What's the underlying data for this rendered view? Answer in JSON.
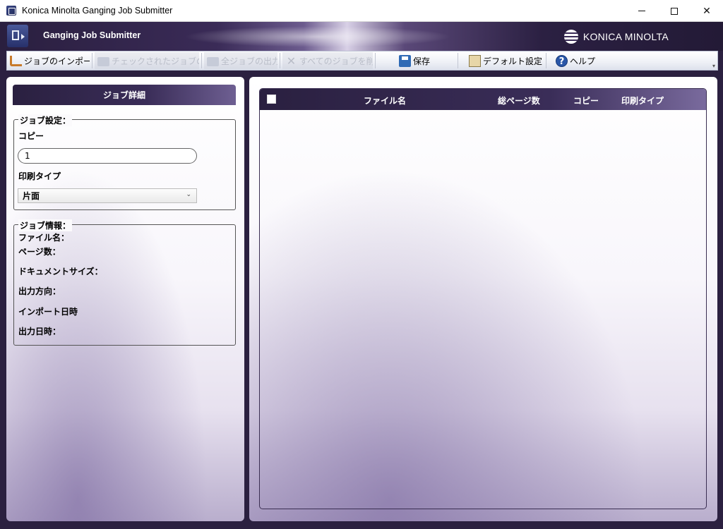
{
  "window": {
    "title": "Konica Minolta Ganging Job Submitter",
    "controls": [
      "minimize",
      "maximize",
      "close"
    ]
  },
  "banner": {
    "app_name": "Ganging Job Submitter",
    "brand": "KONICA MINOLTA"
  },
  "toolbar": {
    "items": [
      {
        "label": "ジョブのインポート",
        "icon": "import-icon",
        "enabled": true
      },
      {
        "label": "チェックされたジョブの出力",
        "icon": "folder-icon",
        "enabled": false
      },
      {
        "label": "全ジョブの出力",
        "icon": "folder-icon",
        "enabled": false
      },
      {
        "label": "すべてのジョブを削除",
        "icon": "delete-icon",
        "enabled": false
      },
      {
        "label": "保存",
        "icon": "save-icon",
        "enabled": true
      },
      {
        "label": "デフォルト設定",
        "icon": "default-settings-icon",
        "enabled": true
      },
      {
        "label": "ヘルプ",
        "icon": "help-icon",
        "enabled": true
      }
    ]
  },
  "job_details": {
    "header": "ジョブ詳細",
    "settings": {
      "legend": "ジョブ設定：",
      "copies_label": "コピー",
      "copies_value": "1",
      "print_type_label": "印刷タイプ",
      "print_type_value": "片面"
    },
    "info": {
      "legend": "ジョブ情報：",
      "file_name_label": "ファイル名：",
      "page_count_label": "ページ数：",
      "document_size_label": "ドキュメントサイズ：",
      "output_direction_label": "出力方向：",
      "import_date_label": "インポート日時",
      "output_date_label": "出力日時："
    }
  },
  "job_table": {
    "columns": [
      "ファイル名",
      "総ページ数",
      "コピー",
      "印刷タイプ"
    ],
    "rows": []
  }
}
